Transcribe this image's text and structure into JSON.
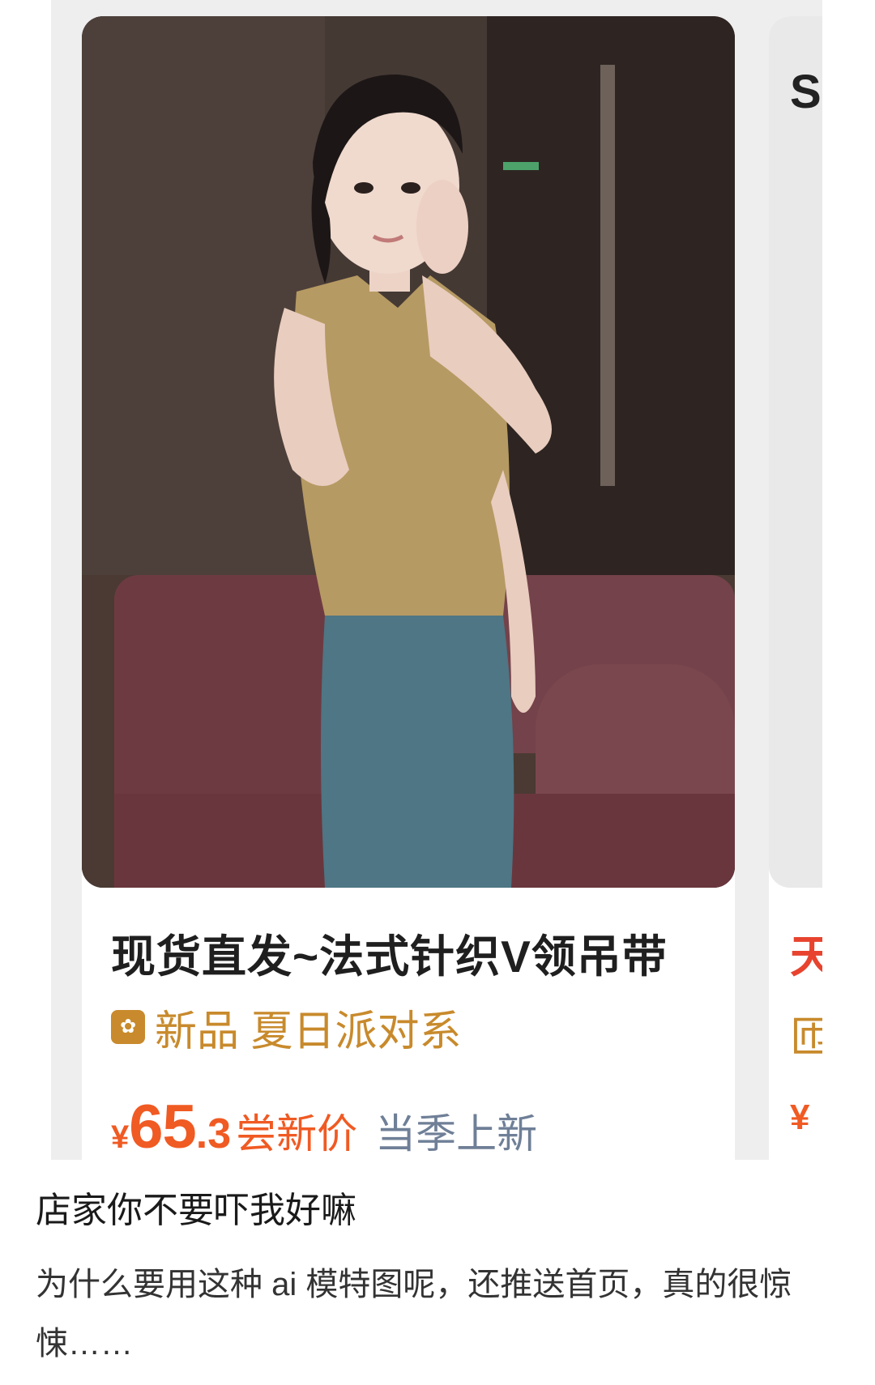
{
  "product_card": {
    "title": "现货直发~法式针织V领吊带",
    "tag_text": "新品 夏日派对系",
    "price_symbol": "¥",
    "price_integer": "65",
    "price_decimal": ".3",
    "price_label": "尝新价",
    "season_text": "当季上新"
  },
  "next_card": {
    "top_fragment": "S",
    "title_fragment": "天",
    "tag_fragment": "匝",
    "price_fragment": "¥"
  },
  "post": {
    "title": "店家你不要吓我好嘛",
    "body": "为什么要用这种 ai 模特图呢，还推送首页，真的很惊悚……"
  },
  "colors": {
    "price": "#f05a23",
    "tag": "#c88a2c",
    "season": "#6f7f97"
  }
}
